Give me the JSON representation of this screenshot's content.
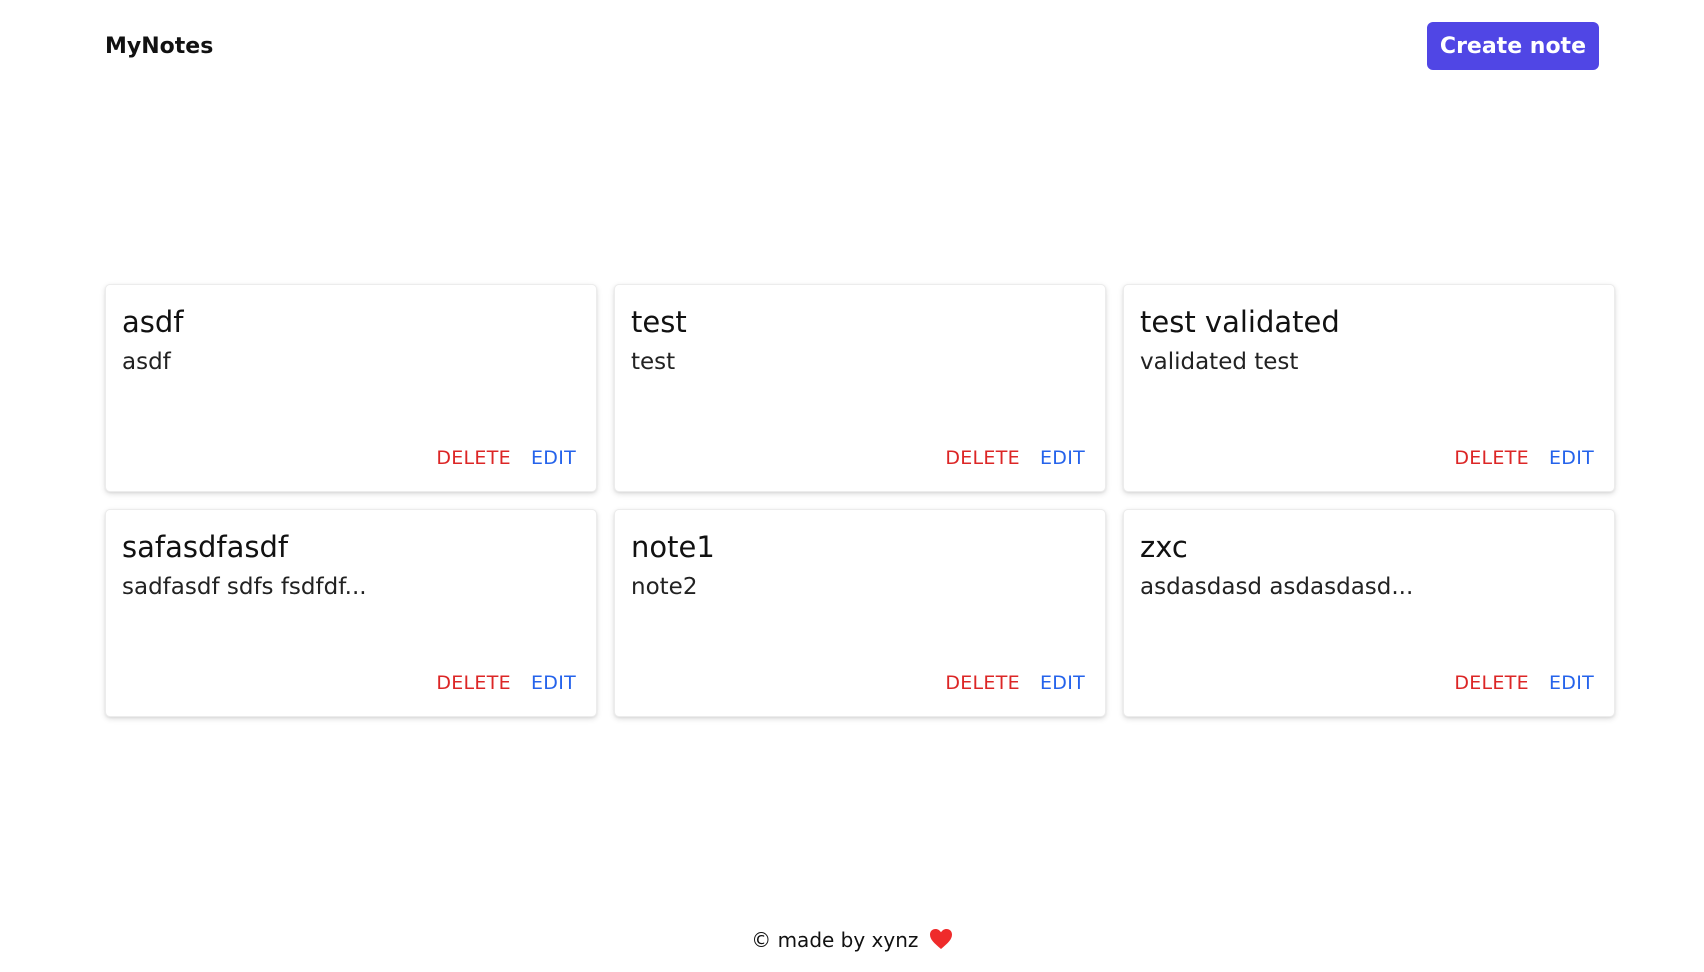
{
  "header": {
    "brand": "MyNotes",
    "create_label": "Create note"
  },
  "notes": [
    {
      "title": "asdf",
      "body": "asdf",
      "delete_label": "DELETE",
      "edit_label": "EDIT"
    },
    {
      "title": "test",
      "body": "test",
      "delete_label": "DELETE",
      "edit_label": "EDIT"
    },
    {
      "title": "test validated",
      "body": "validated test",
      "delete_label": "DELETE",
      "edit_label": "EDIT"
    },
    {
      "title": "safasdfasdf",
      "body": "sadfasdf sdfs fsdfdf...",
      "delete_label": "DELETE",
      "edit_label": "EDIT"
    },
    {
      "title": "note1",
      "body": "note2",
      "delete_label": "DELETE",
      "edit_label": "EDIT"
    },
    {
      "title": "zxc",
      "body": "asdasdasd asdasdasd...",
      "delete_label": "DELETE",
      "edit_label": "EDIT"
    }
  ],
  "footer": {
    "text": "© made by xynz",
    "icon": "heart-icon"
  },
  "colors": {
    "accent": "#5046e5",
    "delete": "#dc2626",
    "edit": "#2563eb",
    "heart": "#ef2b2b"
  }
}
